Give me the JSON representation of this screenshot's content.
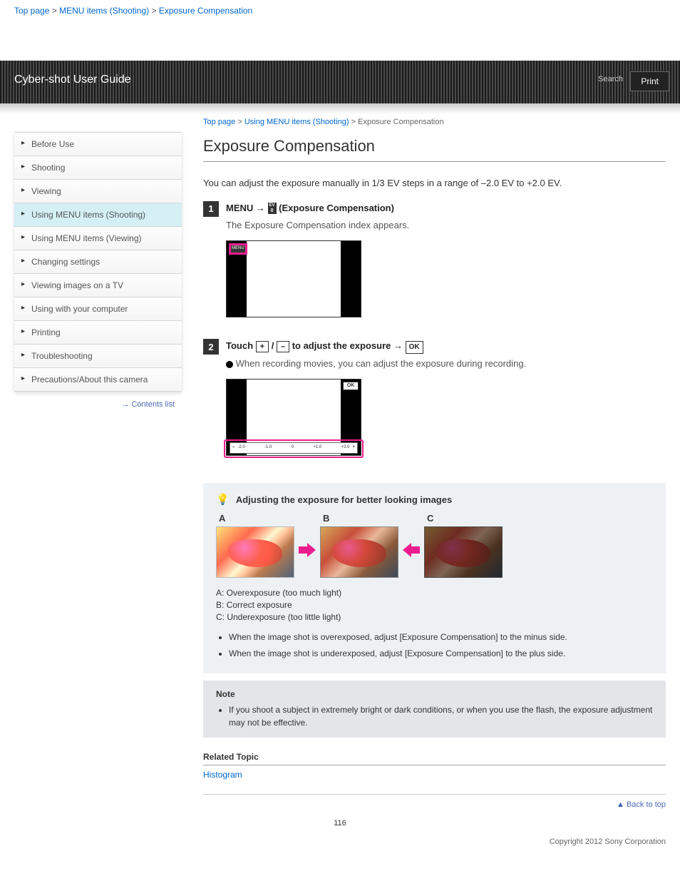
{
  "header": {
    "brand": "Cyber-shot User Guide",
    "search": "Search",
    "print_label": "Print"
  },
  "top_links": {
    "a": "Top page",
    "b": "MENU items (Shooting)",
    "c": "Exposure Compensation"
  },
  "sidebar": {
    "items": [
      {
        "label": "Before Use"
      },
      {
        "label": "Shooting"
      },
      {
        "label": "Viewing"
      },
      {
        "label": "Using MENU items (Shooting)"
      },
      {
        "label": "Using MENU items (Viewing)"
      },
      {
        "label": "Changing settings"
      },
      {
        "label": "Viewing images on a TV"
      },
      {
        "label": "Using with your computer"
      },
      {
        "label": "Printing"
      },
      {
        "label": "Troubleshooting"
      },
      {
        "label": "Precautions/About this camera"
      }
    ],
    "active_index": 3,
    "contents_list": "Contents list"
  },
  "back_to_top": "Back to top",
  "content": {
    "breadcrumb": {
      "a": "Top page",
      "sep": ">",
      "b": "Using MENU items (Shooting)",
      "c": "Exposure Compensation"
    },
    "title": "Exposure Compensation",
    "intro": "You can adjust the exposure manually in 1/3 EV steps in a range of –2.0 EV to +2.0 EV.",
    "step1": {
      "num": "1",
      "main_pre": "MENU",
      "main_arrow": "→",
      "main_post": "(Exposure Compensation)",
      "sub": "The Exposure Compensation index appears."
    },
    "step2": {
      "num": "2",
      "main_a": "Touch",
      "plus": "+",
      "minus": "–",
      "main_b": "to adjust the exposure",
      "main_arrow": "→",
      "ok": "OK",
      "sub": "When recording movies, you can adjust the exposure during recording."
    },
    "tip": {
      "heading": "Adjusting the exposure for better looking images",
      "labels": {
        "a": "A",
        "b": "B",
        "c": "C"
      },
      "legend": {
        "a": "A: Overexposure (too much light)",
        "b": "B: Correct exposure",
        "c": "C: Underexposure (too little light)"
      },
      "bullets": [
        "When the image shot is overexposed, adjust [Exposure Compensation] to the minus side.",
        "When the image shot is underexposed, adjust [Exposure Compensation] to the plus side."
      ]
    },
    "note": {
      "title": "Note",
      "bullets": [
        "If you shoot a subject in extremely bright or dark conditions, or when you use the flash, the exposure adjustment may not be effective."
      ]
    },
    "related": {
      "title": "Related Topic",
      "link": "Histogram"
    }
  },
  "page_number": "116",
  "copyright": "Copyright 2012 Sony Corporation"
}
